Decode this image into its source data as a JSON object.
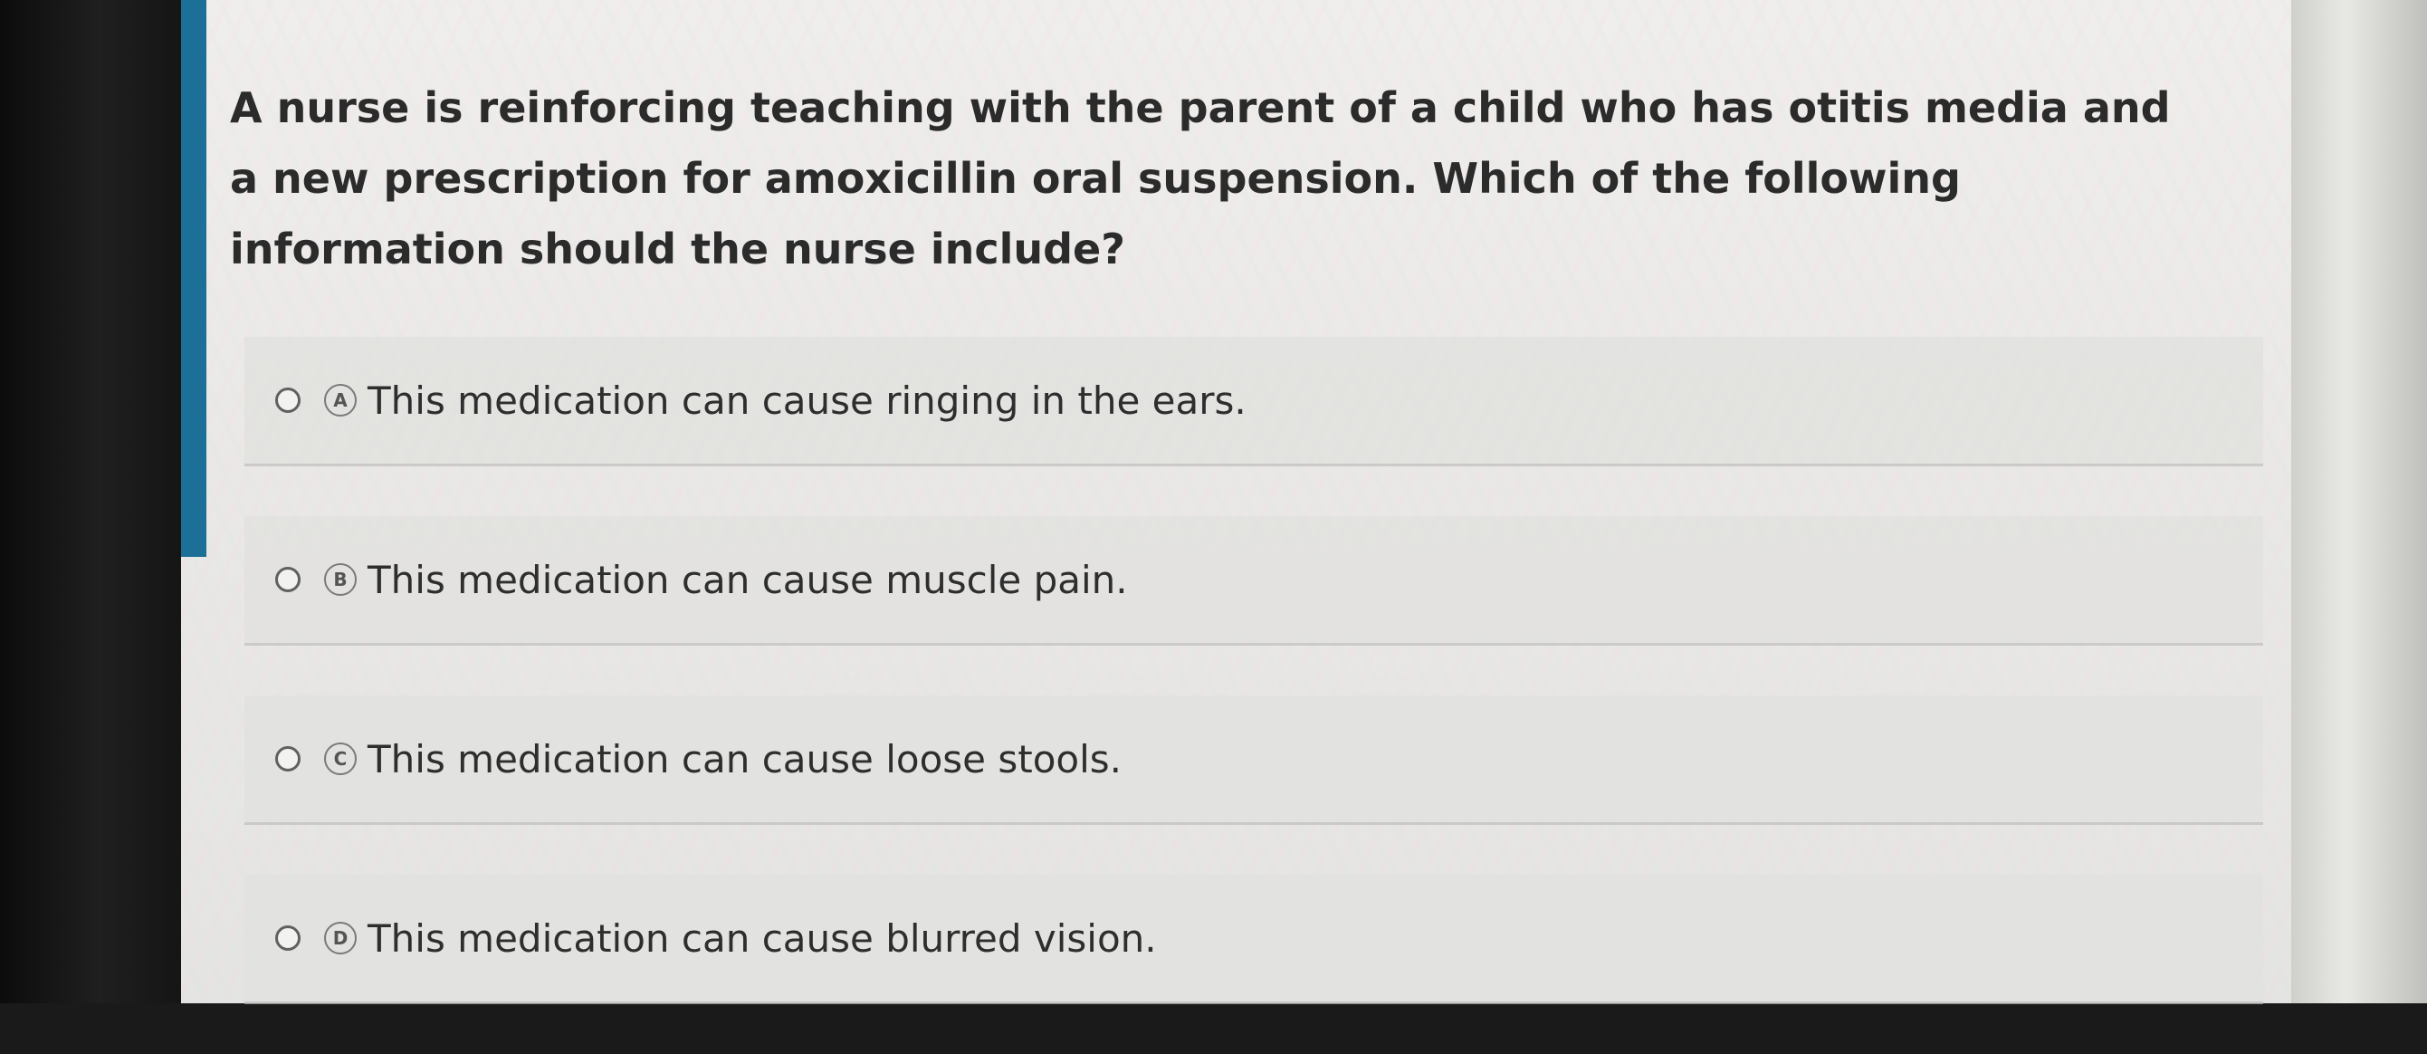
{
  "question": {
    "text": "A nurse is reinforcing teaching with the parent of a child who has otitis media and a new prescription for amoxicillin oral suspension. Which of the following information should the nurse include?"
  },
  "options": [
    {
      "letter": "A",
      "text": "This medication can cause ringing in the ears."
    },
    {
      "letter": "B",
      "text": "This medication can cause muscle pain."
    },
    {
      "letter": "C",
      "text": "This medication can cause loose stools."
    },
    {
      "letter": "D",
      "text": "This medication can cause blurred vision."
    }
  ],
  "colors": {
    "accent_bar": "#1c6f97",
    "text": "#2b2b2b"
  }
}
